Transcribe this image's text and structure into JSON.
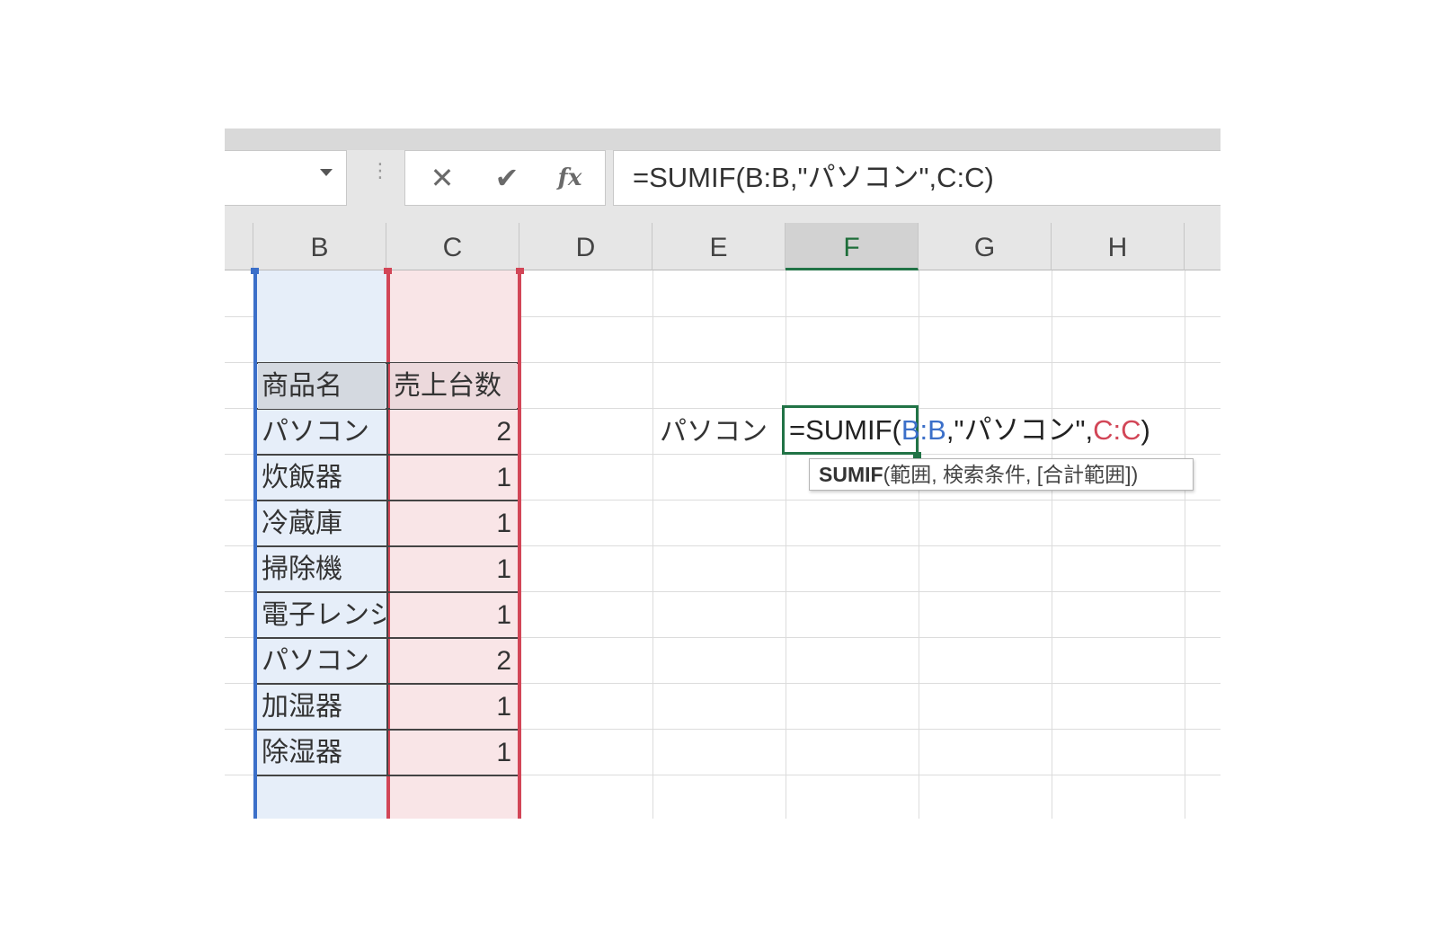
{
  "formula_bar": {
    "cancel_icon": "✕",
    "enter_icon": "✔",
    "fx_label": "fx",
    "formula": "=SUMIF(B:B,\"パソコン\",C:C)"
  },
  "columns": [
    "B",
    "C",
    "D",
    "E",
    "F",
    "G",
    "H"
  ],
  "active_column": "F",
  "table": {
    "headers": [
      "商品名",
      "売上台数"
    ],
    "rows": [
      [
        "パソコン",
        "2"
      ],
      [
        "炊飯器",
        "1"
      ],
      [
        "冷蔵庫",
        "1"
      ],
      [
        "掃除機",
        "1"
      ],
      [
        "電子レンジ",
        "1"
      ],
      [
        "パソコン",
        "2"
      ],
      [
        "加湿器",
        "1"
      ],
      [
        "除湿器",
        "1"
      ]
    ]
  },
  "criteria_cell": "パソコン",
  "editing": {
    "prefix": "=SUMIF(",
    "ref_range": "B:B",
    "middle": ",\"パソコン\",",
    "ref_sum": "C:C",
    "suffix": ")"
  },
  "tooltip": {
    "func": "SUMIF",
    "args": "(範囲, 検索条件, [合計範囲])"
  },
  "colors": {
    "accent_green": "#217346",
    "range_blue": "#3b6fc9",
    "range_red": "#d24657"
  }
}
